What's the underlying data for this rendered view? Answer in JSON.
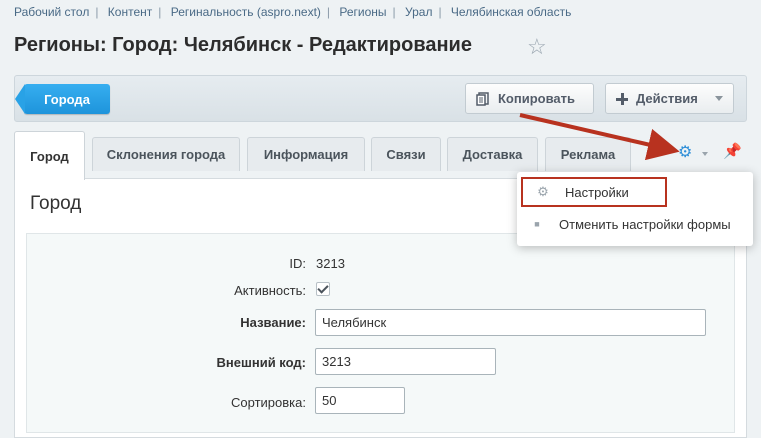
{
  "breadcrumb": [
    "Рабочий стол",
    "Контент",
    "Регинальность (aspro.next)",
    "Регионы",
    "Урал",
    "Челябинская область"
  ],
  "page_title": "Регионы: Город: Челябинск - Редактирование",
  "toolbar": {
    "back_label": "Города",
    "copy_label": "Копировать",
    "actions_label": "Действия"
  },
  "tabs": [
    {
      "label": "Город",
      "active": true
    },
    {
      "label": "Склонения города"
    },
    {
      "label": "Информация"
    },
    {
      "label": "Связи"
    },
    {
      "label": "Доставка"
    },
    {
      "label": "Реклама"
    }
  ],
  "menu": {
    "settings_label": "Настройки",
    "reset_label": "Отменить настройки формы"
  },
  "section_title": "Город",
  "form": {
    "id_label": "ID:",
    "id_value": "3213",
    "active_label": "Активность:",
    "active_checked": true,
    "name_label": "Название:",
    "name_value": "Челябинск",
    "external_code_label": "Внешний код:",
    "external_code_value": "3213",
    "sort_label": "Сортировка:",
    "sort_value": "50"
  },
  "colors": {
    "accent": "#2f8fd8",
    "highlight": "#b8321f"
  }
}
